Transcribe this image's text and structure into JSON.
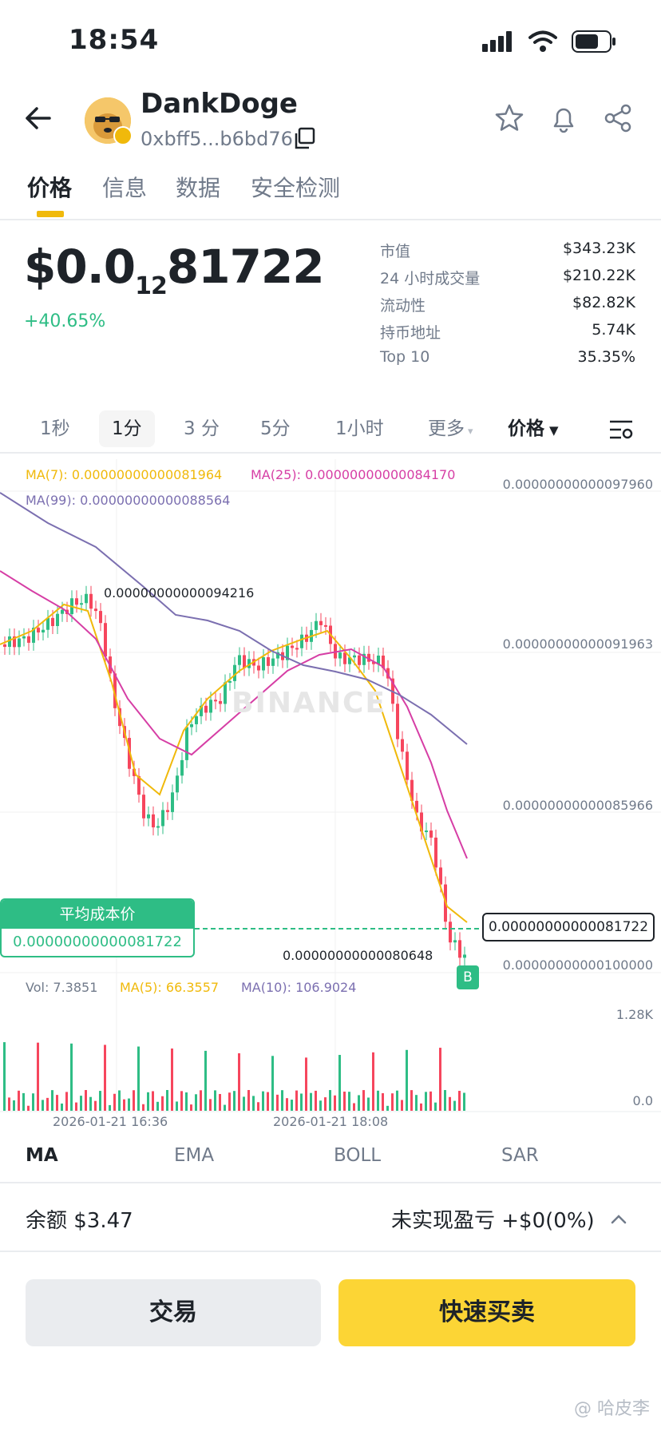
{
  "status_bar": {
    "time": "18:54"
  },
  "header": {
    "token_name": "DankDoge",
    "address": "0xbff5...b6bd76"
  },
  "tabs": [
    "价格",
    "信息",
    "数据",
    "安全检测"
  ],
  "price": {
    "lead": "$0.0",
    "zero_count": "12",
    "tail": "81722",
    "change": "+40.65%"
  },
  "stats": [
    {
      "label": "市值",
      "value": "$343.23K"
    },
    {
      "label": "24 小时成交量",
      "value": "$210.22K"
    },
    {
      "label": "流动性",
      "value": "$82.82K"
    },
    {
      "label": "持币地址",
      "value": "5.74K"
    },
    {
      "label": "Top 10",
      "value": "35.35%"
    }
  ],
  "intervals": [
    "1秒",
    "1分",
    "3 分",
    "5分",
    "1小时",
    "更多",
    "价格"
  ],
  "chart": {
    "ma7": "MA(7): 0.00000000000081964",
    "ma25": "MA(25): 0.00000000000084170",
    "ma99": "MA(99): 0.00000000000088564",
    "axis": [
      "0.00000000000097960",
      "0.00000000000091963",
      "0.00000000000085966",
      "0.00000000000100000"
    ],
    "high_label": "0.00000000000094216",
    "low_label": "0.00000000000080648",
    "current_price": "0.00000000000081722",
    "avg_cost_title": "平均成本价",
    "avg_cost_value": "0.00000000000081722",
    "buy_marker": "B",
    "watermark": "BINANCE",
    "vol": "Vol: 7.3851",
    "vol_ma5": "MA(5): 66.3557",
    "vol_ma10": "MA(10): 106.9024",
    "vol_axis_top": "1.28K",
    "vol_axis_bottom": "0.0",
    "dates": [
      "2026-01-21 16:36",
      "2026-01-21 18:08"
    ],
    "colors": {
      "up": "#2ebd85",
      "down": "#f6465d",
      "ma7": "#f0b90b",
      "ma25": "#d63ea5",
      "ma99": "#7b6fb0"
    }
  },
  "indicators": [
    "MA",
    "EMA",
    "BOLL",
    "SAR"
  ],
  "balance": {
    "label": "余额 $3.47",
    "pnl": "未实现盈亏 +$0(0%)"
  },
  "buttons": {
    "trade": "交易",
    "quick": "快速买卖"
  },
  "credit": "@ 哈皮李"
}
